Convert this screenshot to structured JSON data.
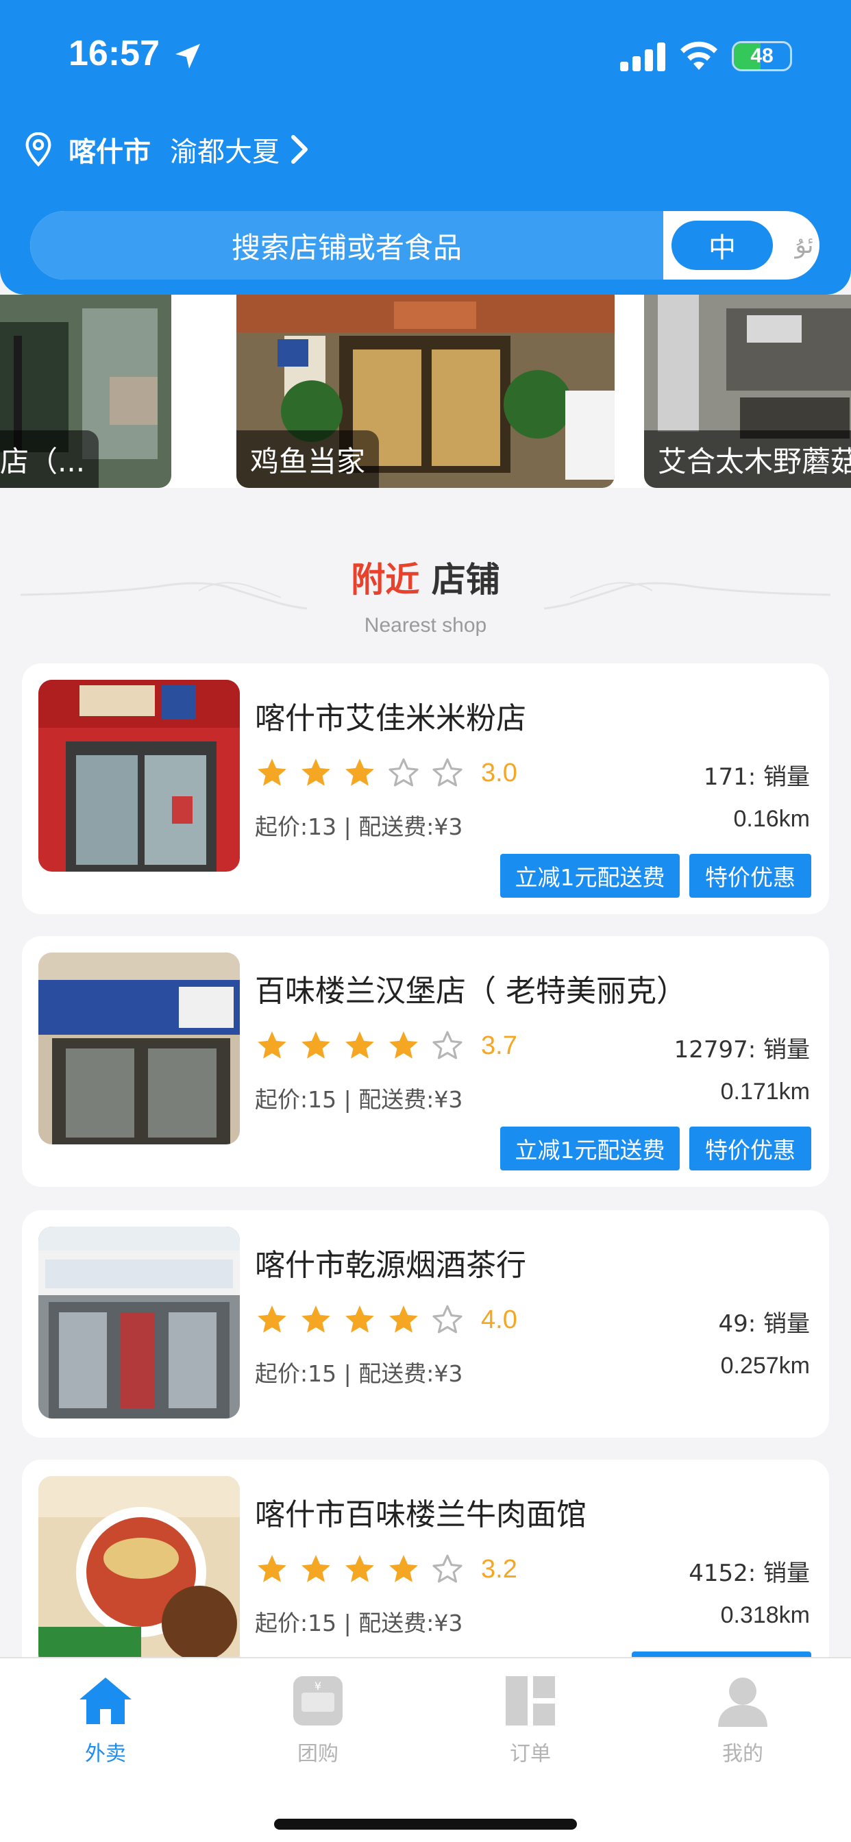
{
  "status_bar": {
    "time": "16:57",
    "battery": "48",
    "battery_level": 0.48
  },
  "location": {
    "city": "喀什市",
    "address": "渝都大夏"
  },
  "search": {
    "placeholder": "搜索店铺或者食品",
    "lang_active": "中",
    "lang_inactive": "ئۇ"
  },
  "banners": [
    {
      "caption": "店（..."
    },
    {
      "caption": "鸡鱼当家"
    },
    {
      "caption": "艾合太木野蘑菇"
    }
  ],
  "section": {
    "title_highlight": "附近",
    "title_rest": "店铺",
    "subtitle": "Nearest shop"
  },
  "shops": [
    {
      "name": "喀什市艾佳米米粉店",
      "rating": "3.0",
      "rating_value": 3.0,
      "sales": "171:  销量",
      "fee": "起价:13 | 配送费:¥3",
      "distance": "0.16km",
      "promo1": "立减1元配送费",
      "promo2": "特价优惠"
    },
    {
      "name": "百味楼兰汉堡店（ 老特美丽克）",
      "rating": "3.7",
      "rating_value": 3.7,
      "sales": "12797:  销量",
      "fee": "起价:15 | 配送费:¥3",
      "distance": "0.171km",
      "promo1": "立减1元配送费",
      "promo2": "特价优惠"
    },
    {
      "name": "喀什市乾源烟酒茶行",
      "rating": "4.0",
      "rating_value": 4.0,
      "sales": "49:  销量",
      "fee": "起价:15 | 配送费:¥3",
      "distance": "0.257km"
    },
    {
      "name": "喀什市百味楼兰牛肉面馆",
      "rating": "3.2",
      "rating_value": 3.2,
      "sales": "4152:  销量",
      "fee": "起价:15 | 配送费:¥3",
      "distance": "0.318km"
    }
  ],
  "tabbar": {
    "takeout": "外卖",
    "group_buy": "团购",
    "orders": "订单",
    "mine": "我的"
  },
  "colors": {
    "primary": "#1a8df0",
    "star": "#f5a623",
    "accent_red": "#e8412c"
  }
}
